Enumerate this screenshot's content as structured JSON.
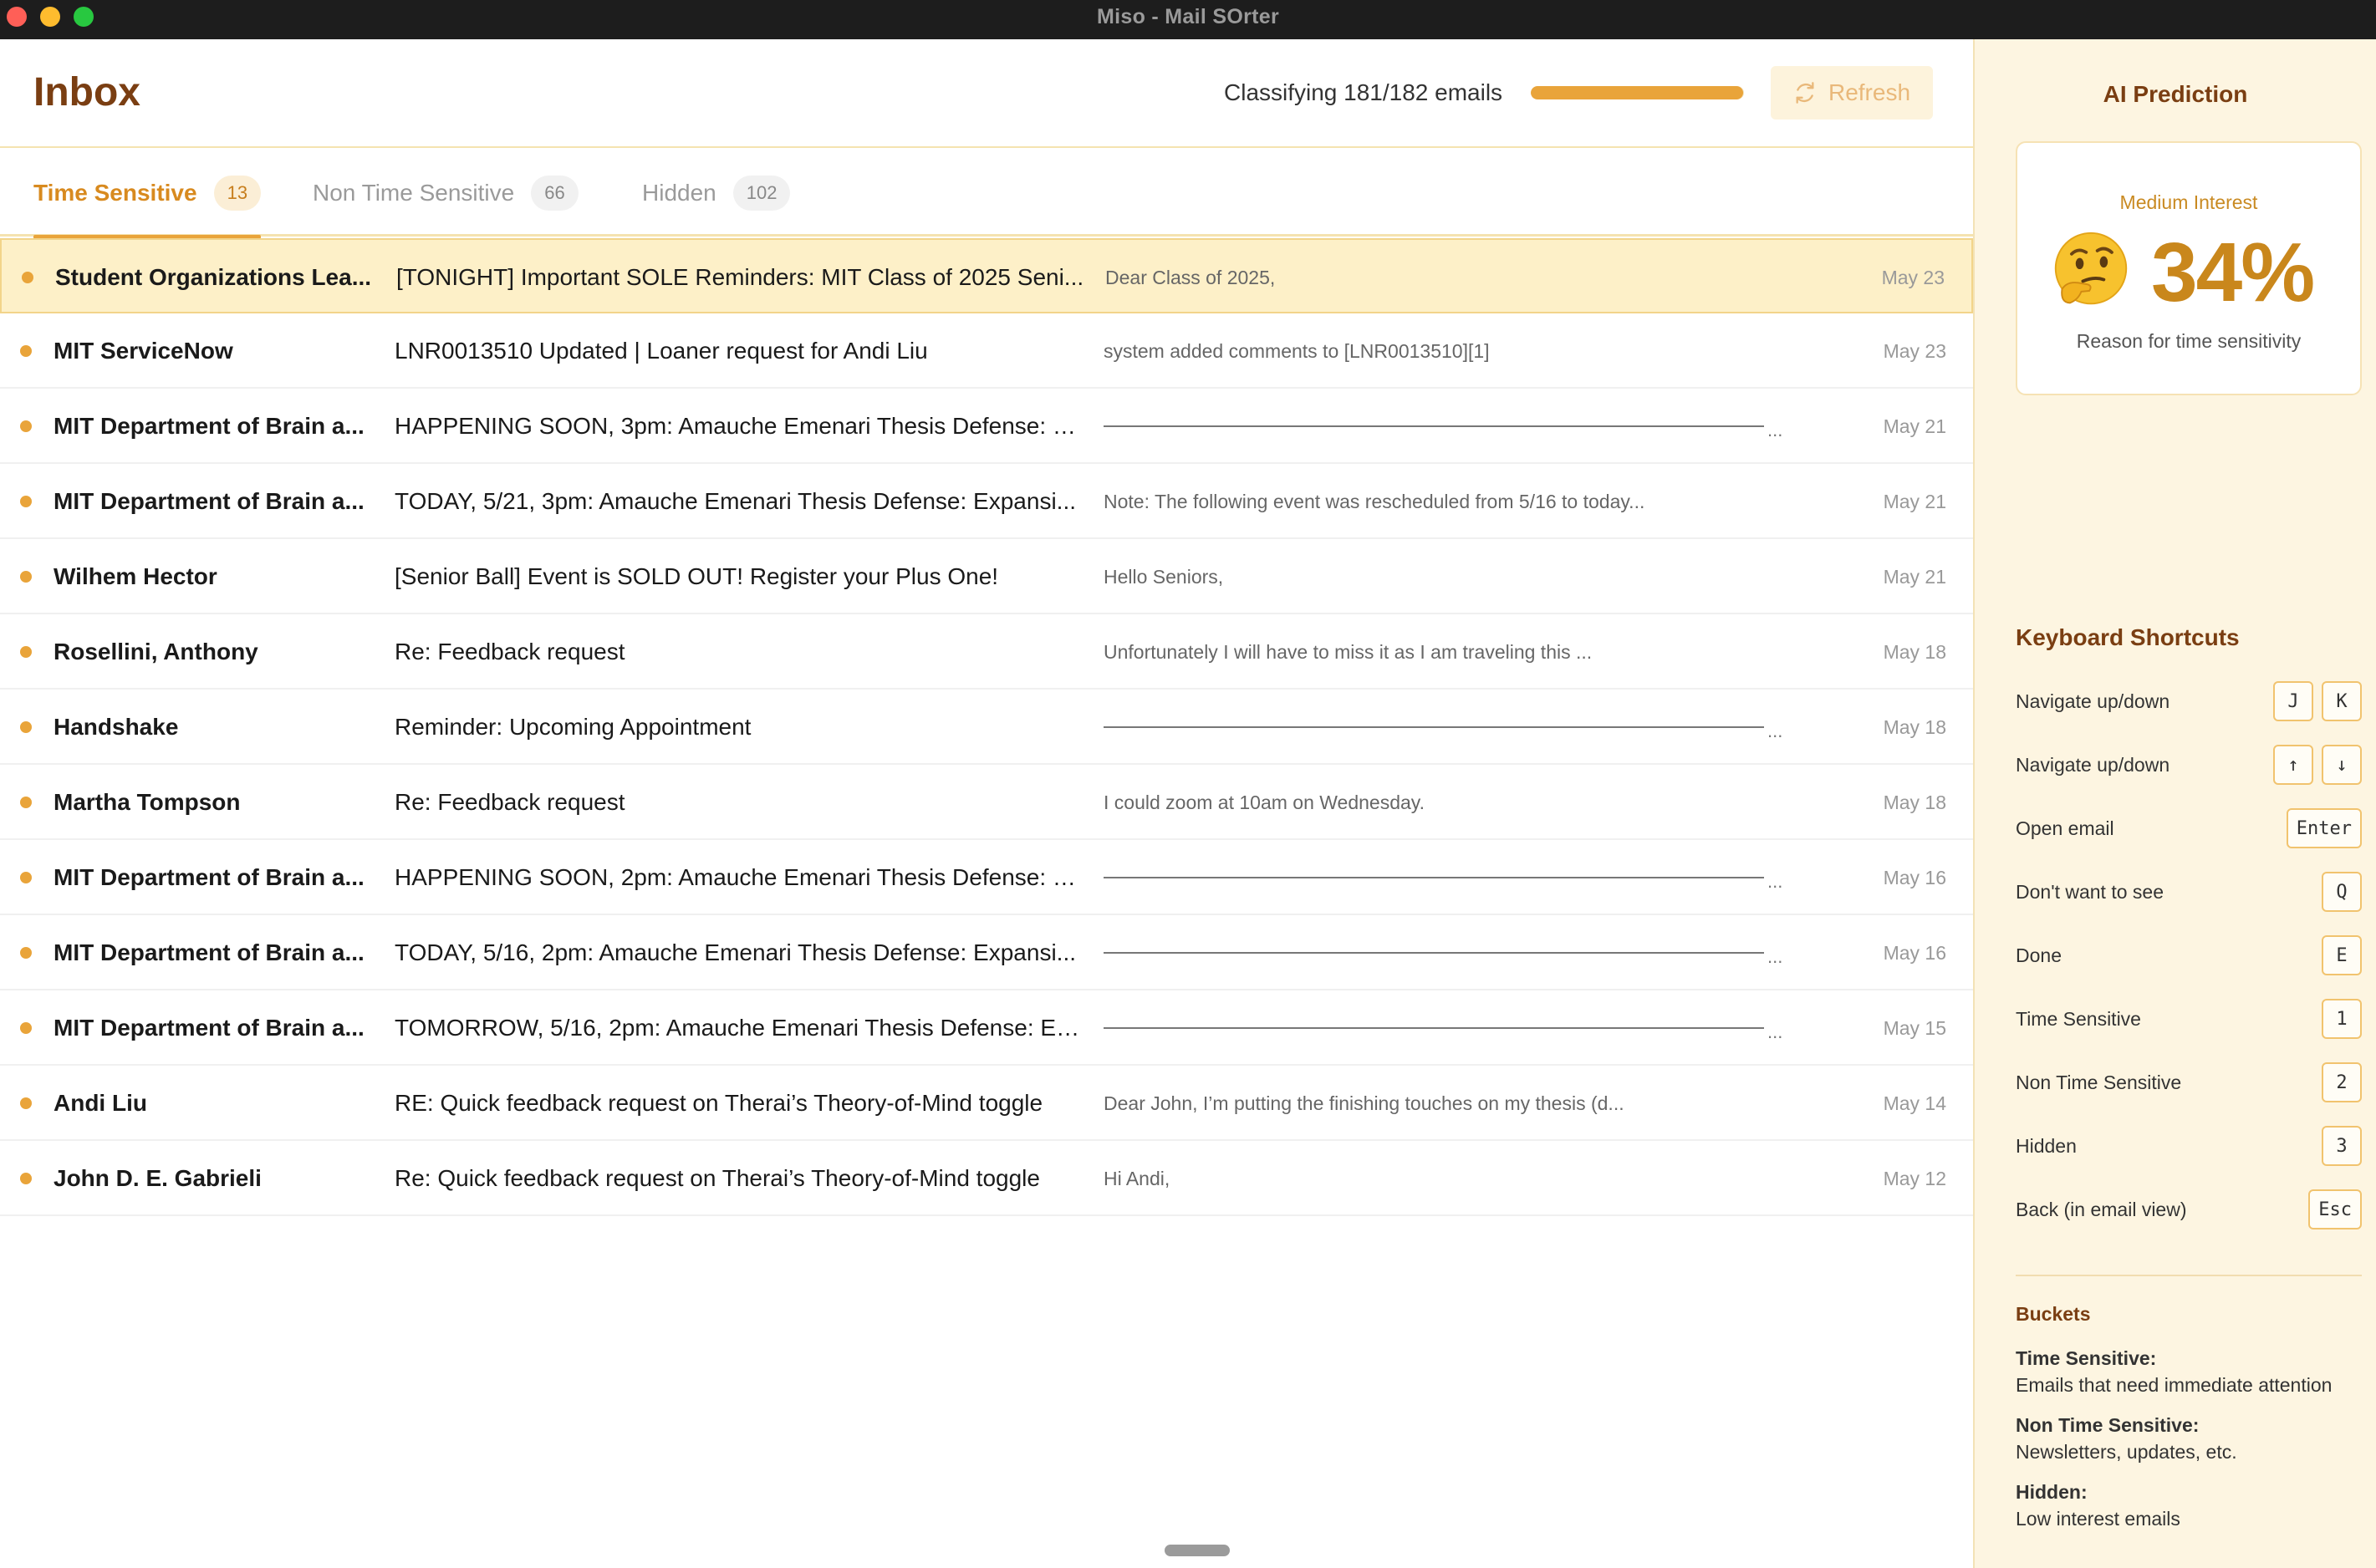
{
  "window": {
    "title": "Miso - Mail SOrter"
  },
  "header": {
    "title": "Inbox",
    "classifying_text": "Classifying 181/182 emails",
    "progress": 0.9945,
    "refresh_label": "Refresh"
  },
  "tabs": [
    {
      "label": "Time Sensitive",
      "count": "13",
      "active": true
    },
    {
      "label": "Non Time Sensitive",
      "count": "66",
      "active": false
    },
    {
      "label": "Hidden",
      "count": "102",
      "active": false
    }
  ],
  "emails": [
    {
      "sender": "Student Organizations Lea...",
      "subject": "[TONIGHT] Important SOLE Reminders: MIT Class of 2025 Seni...",
      "preview": "Dear Class of 2025,",
      "date": "May 23"
    },
    {
      "sender": "MIT ServiceNow",
      "subject": "LNR0013510 Updated | Loaner request for Andi Liu",
      "preview": "system added comments to [LNR0013510][1]",
      "date": "May 23"
    },
    {
      "sender": "MIT Department of Brain a...",
      "subject": "HAPPENING SOON, 3pm: Amauche Emenari Thesis Defense: Ex...",
      "preview": "...",
      "date": "May 21"
    },
    {
      "sender": "MIT Department of Brain a...",
      "subject": "TODAY, 5/21, 3pm: Amauche Emenari Thesis Defense: Expansi...",
      "preview": "Note: The following event was rescheduled from 5/16 to today...",
      "date": "May 21"
    },
    {
      "sender": "Wilhem Hector",
      "subject": "[Senior Ball] Event is SOLD OUT! Register your Plus One!",
      "preview": "Hello Seniors,",
      "date": "May 21"
    },
    {
      "sender": "Rosellini, Anthony",
      "subject": "Re: Feedback request",
      "preview": "Unfortunately I will have to miss it as I am traveling this ...",
      "date": "May 18"
    },
    {
      "sender": "Handshake",
      "subject": "Reminder: Upcoming Appointment",
      "preview": "...",
      "date": "May 18"
    },
    {
      "sender": "Martha Tompson",
      "subject": "Re: Feedback request",
      "preview": "I could zoom at 10am on Wednesday.",
      "date": "May 18"
    },
    {
      "sender": "MIT Department of Brain a...",
      "subject": "HAPPENING SOON, 2pm: Amauche Emenari Thesis Defense: Ex...",
      "preview": "...",
      "date": "May 16"
    },
    {
      "sender": "MIT Department of Brain a...",
      "subject": "TODAY, 5/16, 2pm: Amauche Emenari Thesis Defense: Expansi...",
      "preview": "...",
      "date": "May 16"
    },
    {
      "sender": "MIT Department of Brain a...",
      "subject": "TOMORROW, 5/16, 2pm: Amauche Emenari Thesis Defense: Ex...",
      "preview": "...",
      "date": "May 15"
    },
    {
      "sender": "Andi Liu",
      "subject": "RE: Quick feedback request on Therai’s Theory-of-Mind toggle",
      "preview": "Dear John, I’m putting the finishing touches on my thesis (d...",
      "date": "May 14"
    },
    {
      "sender": "John D. E. Gabrieli",
      "subject": "Re: Quick feedback request on Therai’s Theory-of-Mind toggle",
      "preview": "Hi Andi,",
      "date": "May 12"
    }
  ],
  "ai_prediction": {
    "title": "AI Prediction",
    "level": "Medium Interest",
    "emoji": "thinking-face-icon",
    "percent": "34%",
    "reason": "Reason for time sensitivity"
  },
  "shortcuts": {
    "title": "Keyboard Shortcuts",
    "items": [
      {
        "label": "Navigate up/down",
        "keys": [
          "J",
          "K"
        ]
      },
      {
        "label": "Navigate up/down",
        "keys": [
          "↑",
          "↓"
        ]
      },
      {
        "label": "Open email",
        "keys": [
          "Enter"
        ]
      },
      {
        "label": "Don't want to see",
        "keys": [
          "Q"
        ]
      },
      {
        "label": "Done",
        "keys": [
          "E"
        ]
      },
      {
        "label": "Time Sensitive",
        "keys": [
          "1"
        ]
      },
      {
        "label": "Non Time Sensitive",
        "keys": [
          "2"
        ]
      },
      {
        "label": "Hidden",
        "keys": [
          "3"
        ]
      },
      {
        "label": "Back (in email view)",
        "keys": [
          "Esc"
        ]
      }
    ]
  },
  "buckets": {
    "title": "Buckets",
    "items": [
      {
        "name": "Time Sensitive:",
        "desc": "Emails that need immediate attention"
      },
      {
        "name": "Non Time Sensitive:",
        "desc": "Newsletters, updates, etc."
      },
      {
        "name": "Hidden:",
        "desc": "Low interest emails"
      }
    ]
  },
  "colors": {
    "accent": "#e9a43a",
    "brand_text": "#7a3e12",
    "selected_row": "#fdf0c8",
    "side_panel": "#fdf5e1"
  }
}
